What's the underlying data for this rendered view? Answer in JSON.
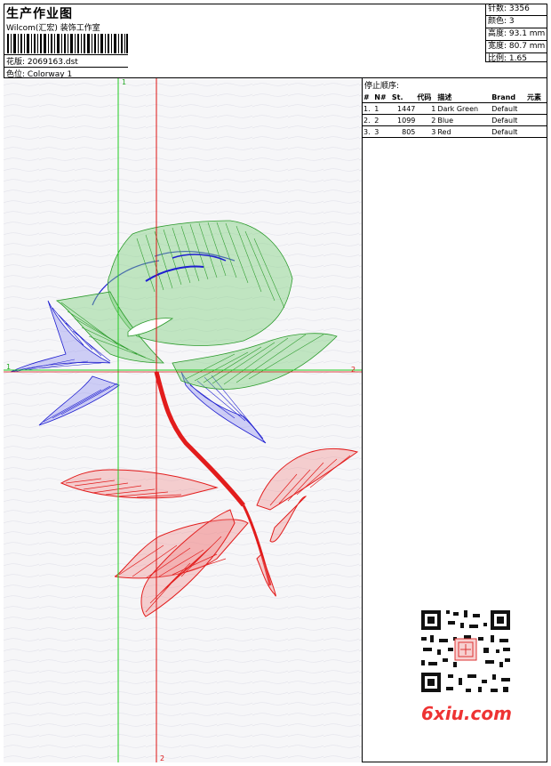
{
  "header": {
    "title": "生产作业图",
    "company": "Wilcom(汇宏) 装饰工作室",
    "design_label": "花版:",
    "design_value": "2069163.dst",
    "colorway_label": "色位:",
    "colorway_value": "Colorway 1"
  },
  "specs": {
    "stitches": "针数: 3356",
    "colors": "颜色: 3",
    "height": "高度: 93.1 mm",
    "width": "宽度: 80.7 mm",
    "ratio": "比例: 1.65"
  },
  "stop_sequence": {
    "title": "停止顺序:",
    "columns": [
      "#",
      "N#",
      "St.",
      "代码",
      "描述",
      "Brand",
      "元素"
    ],
    "rows": [
      {
        "idx": "1.",
        "n": "1",
        "color": "#1a8c1a",
        "st": "1447",
        "code": "1",
        "desc": "Dark Green",
        "brand": "Default"
      },
      {
        "idx": "2.",
        "n": "2",
        "color": "#1a1acc",
        "st": "1099",
        "code": "2",
        "desc": "Blue",
        "brand": "Default"
      },
      {
        "idx": "3.",
        "n": "3",
        "color": "#dd2222",
        "st": "805",
        "code": "3",
        "desc": "Red",
        "brand": "Default"
      }
    ]
  },
  "design_area": {
    "guide_labels": {
      "v1": "1",
      "h1": "1",
      "h2": "2",
      "v2": "2"
    }
  },
  "watermark": "6xiu.com"
}
